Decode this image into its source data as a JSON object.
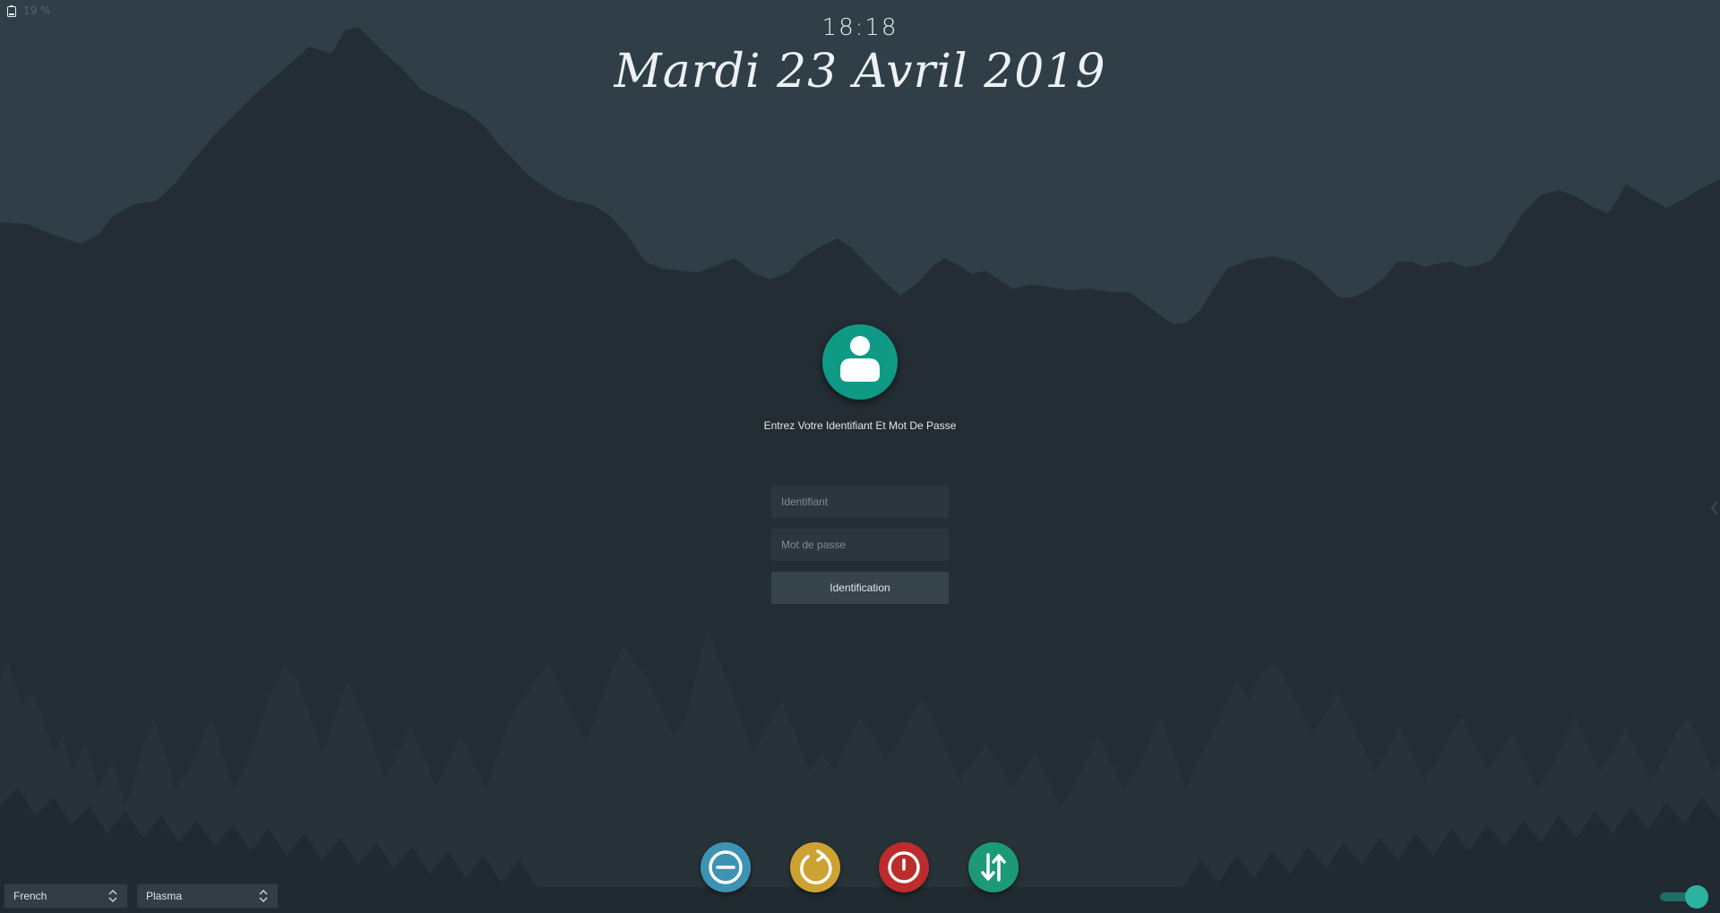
{
  "status": {
    "battery_text": "19 %"
  },
  "clock": {
    "time": "18:18",
    "date": "Mardi 23 Avril 2019"
  },
  "login": {
    "prompt": "Entrez Votre Identifiant Et Mot De Passe",
    "username_placeholder": "Identifiant",
    "password_placeholder": "Mot de passe",
    "login_button_label": "Identification"
  },
  "power_actions": [
    {
      "name": "suspend",
      "icon": "minus-circle-icon",
      "color": "#3c93b4"
    },
    {
      "name": "reboot",
      "icon": "refresh-icon",
      "color": "#cda232"
    },
    {
      "name": "shutdown",
      "icon": "power-icon",
      "color": "#bd2c2c"
    },
    {
      "name": "switch-user",
      "icon": "swap-arrows-icon",
      "color": "#1c9a78"
    }
  ],
  "footer": {
    "keyboard_layout": "French",
    "session": "Plasma"
  },
  "colors": {
    "accent": "#0f9a86",
    "background_sky": "#2f3e47",
    "background_mountain": "#232d33"
  }
}
